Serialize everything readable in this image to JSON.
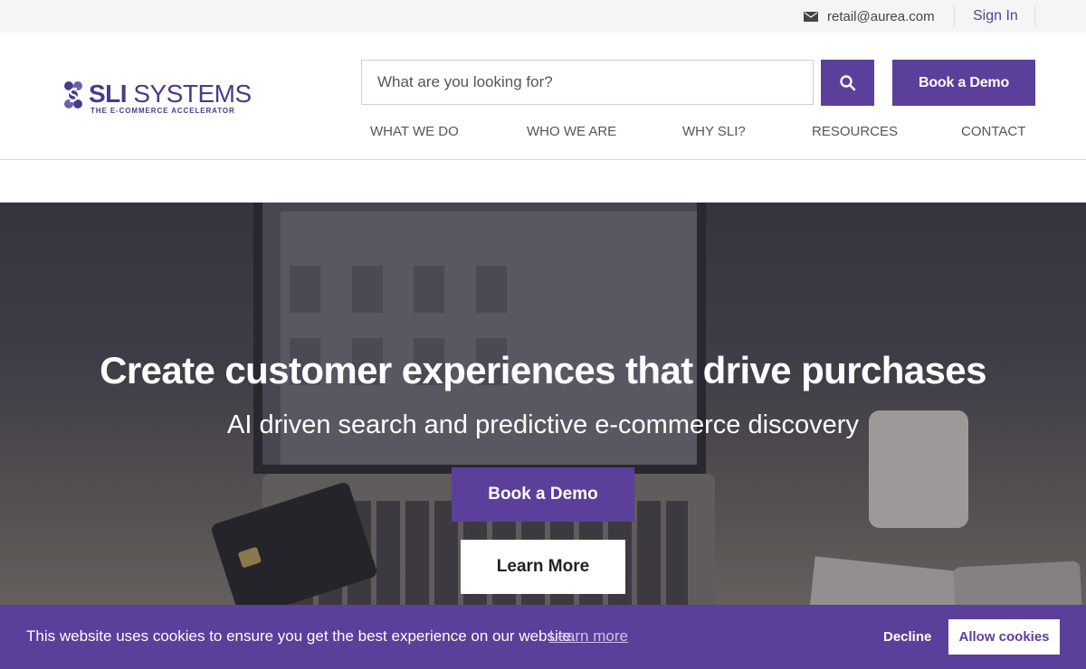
{
  "topbar": {
    "email": "retail@aurea.com",
    "email_icon": "envelope-icon",
    "sign_in": "Sign In"
  },
  "logo": {
    "brand_bold": "SLI",
    "brand_light": "SYSTEMS",
    "tagline": "THE E-COMMERCE ACCELERATOR"
  },
  "search": {
    "placeholder": "What are you looking for?",
    "icon": "search-icon"
  },
  "header": {
    "book_demo": "Book a Demo"
  },
  "nav": {
    "items": [
      {
        "label": "WHAT WE DO"
      },
      {
        "label": "WHO WE ARE"
      },
      {
        "label": "WHY SLI?"
      },
      {
        "label": "RESOURCES"
      },
      {
        "label": "CONTACT"
      }
    ]
  },
  "hero": {
    "headline": "Create customer experiences that drive purchases",
    "subheadline": "AI driven search and predictive e-commerce discovery",
    "primary_cta": "Book a Demo",
    "secondary_cta": "Learn More"
  },
  "cookie": {
    "message": "This website uses cookies to ensure you get the best experience on our website.",
    "learn_more": "Learn more",
    "decline": "Decline",
    "allow": "Allow cookies"
  },
  "colors": {
    "brand_purple": "#5b3f9a",
    "logo_navy": "#4a3c8c"
  }
}
